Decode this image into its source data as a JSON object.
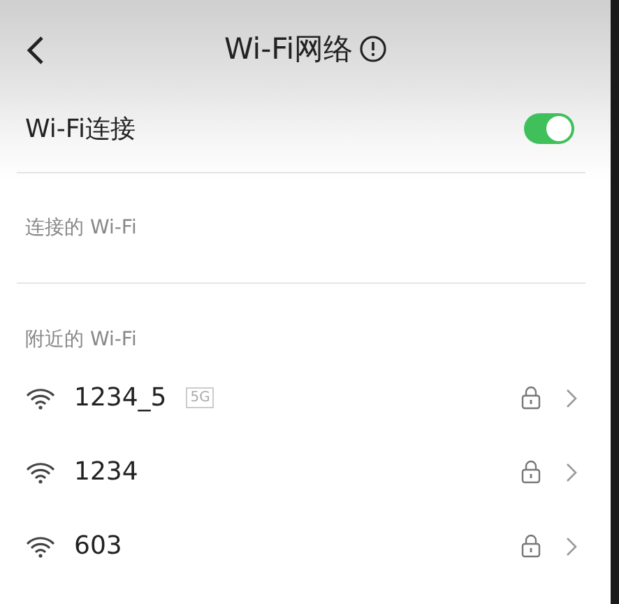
{
  "header": {
    "title": "Wi-Fi网络"
  },
  "wifi_toggle": {
    "label": "Wi-Fi连接",
    "on": true
  },
  "connected_section": {
    "title": "连接的 Wi-Fi"
  },
  "nearby_section": {
    "title": "附近的 Wi-Fi"
  },
  "networks": [
    {
      "name": "1234_5",
      "band": "5G",
      "locked": true
    },
    {
      "name": "1234",
      "locked": true
    },
    {
      "name": "603",
      "locked": true
    }
  ]
}
